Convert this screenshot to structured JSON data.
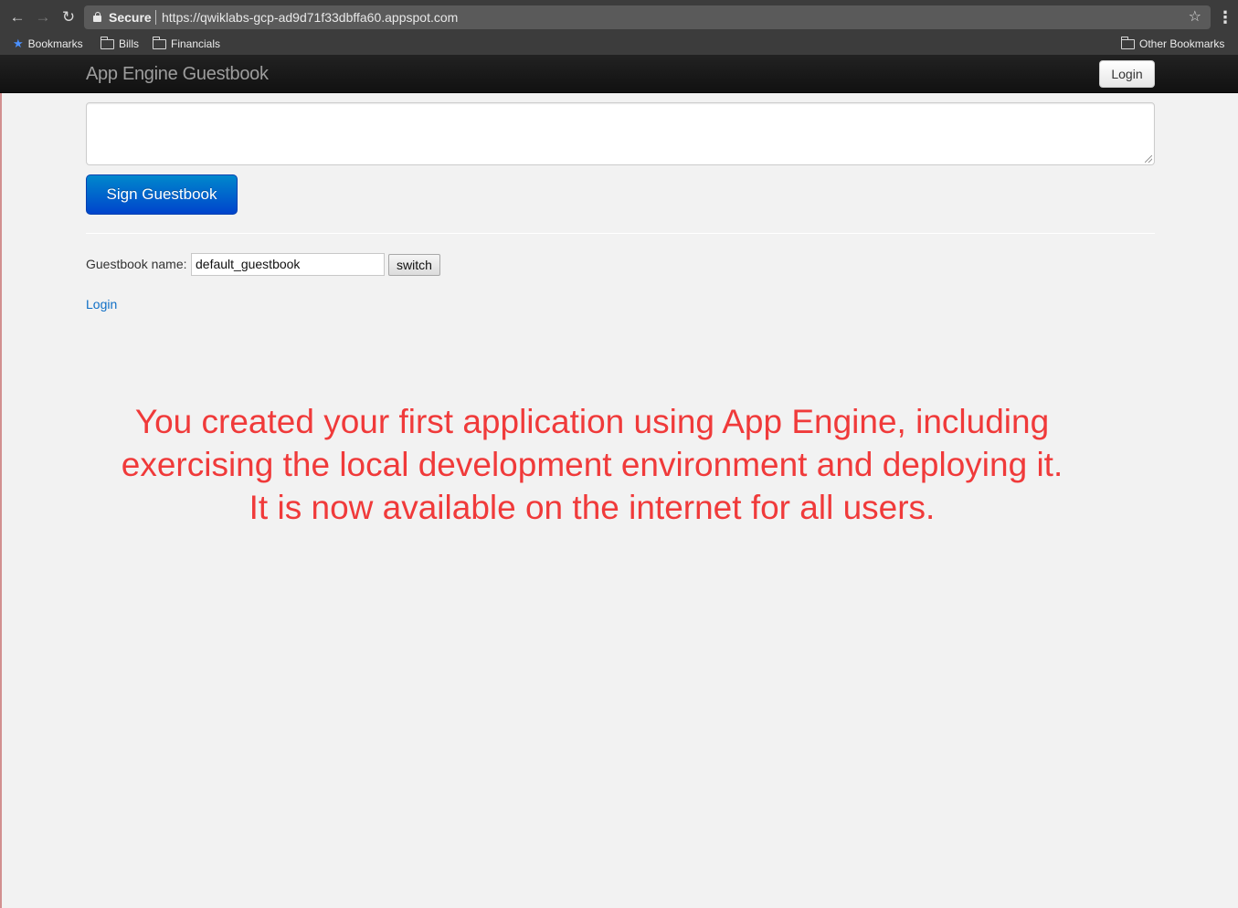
{
  "browser": {
    "secure_label": "Secure",
    "url": "https://qwiklabs-gcp-ad9d71f33dbffa60.appspot.com",
    "icons": {
      "back": "arrow-left-icon",
      "forward": "arrow-right-icon",
      "reload": "reload-icon",
      "lock": "lock-icon",
      "bookmark_star": "star-outline-icon",
      "menu": "kebab-menu-icon"
    },
    "bookmarks": {
      "bookmarks_label": "Bookmarks",
      "bills_label": "Bills",
      "financials_label": "Financials",
      "other_label": "Other Bookmarks"
    }
  },
  "app": {
    "brand": "App Engine Guestbook",
    "nav_login": "Login",
    "sign_button": "Sign Guestbook",
    "guestbook_label": "Guestbook name:",
    "guestbook_value": "default_guestbook",
    "switch_button": "switch",
    "login_link": "Login"
  },
  "message": {
    "line1": "You created your first application using App Engine, including",
    "line2": "exercising the local development environment and deploying it.",
    "line3": "It is now available on the internet for all users."
  },
  "colors": {
    "navbar": "#1b1b1b",
    "primary_button": "#0055cc",
    "link": "#0f6fc6",
    "message": "#f03a3a",
    "page_background": "#f2f2f2"
  }
}
